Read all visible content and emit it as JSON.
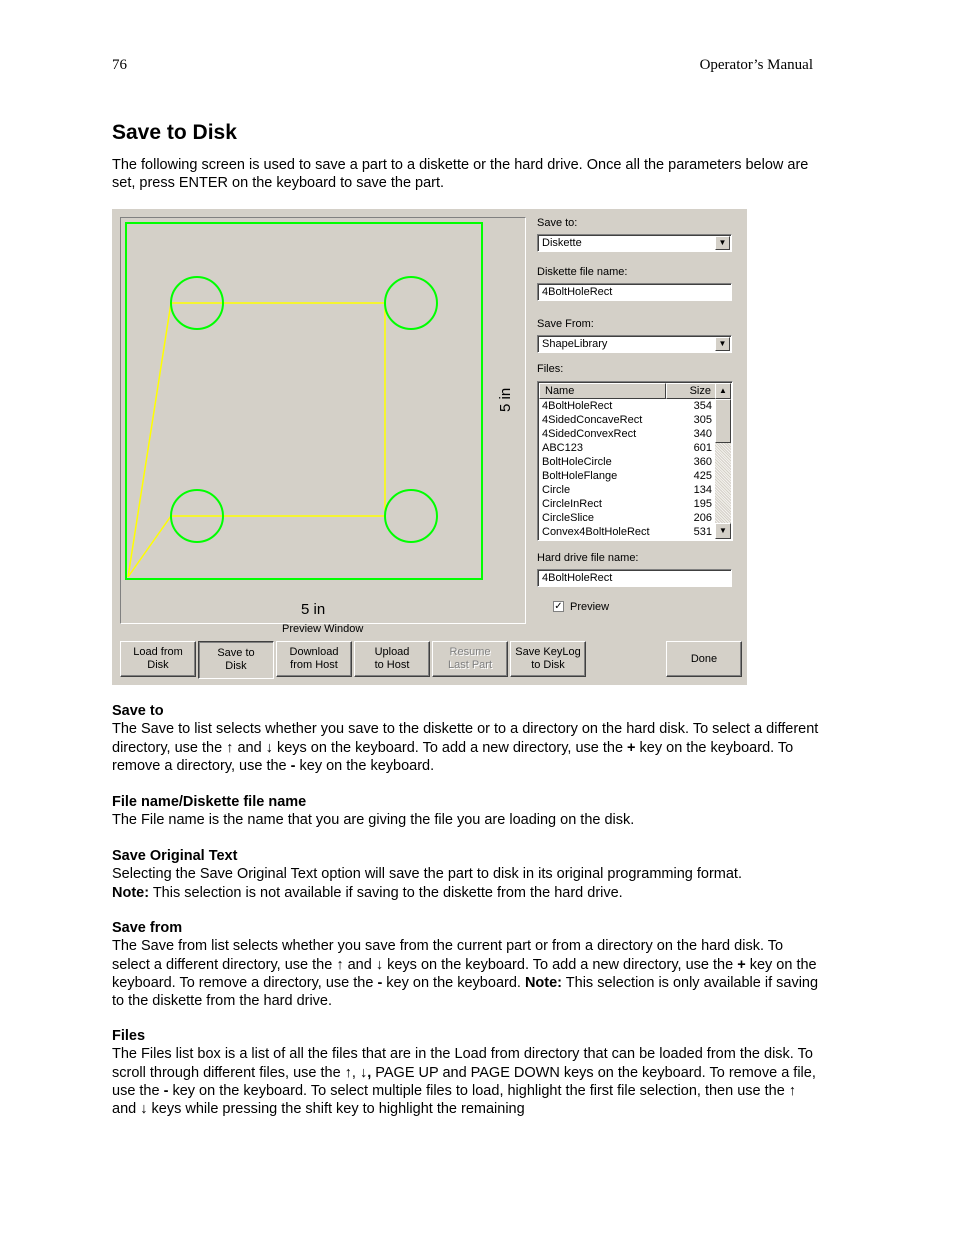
{
  "header": {
    "page_number": "76",
    "manual_title": "Operator’s Manual"
  },
  "title": "Save to Disk",
  "intro": "The following screen is used to save a part to a diskette or the hard drive.  Once all the parameters below are set, press ENTER on the keyboard to save the part.",
  "screen": {
    "preview_dim_x": "5 in",
    "preview_dim_y": "5 in",
    "preview_caption": "Preview Window",
    "save_to_label": "Save to:",
    "save_to_value": "Diskette",
    "diskette_file_label": "Diskette file name:",
    "diskette_file_value": "4BoltHoleRect",
    "save_from_label": "Save From:",
    "save_from_value": "ShapeLibrary",
    "files_label": "Files:",
    "col_name": "Name",
    "col_size": "Size",
    "files": [
      {
        "name": "4BoltHoleRect",
        "size": "354"
      },
      {
        "name": "4SidedConcaveRect",
        "size": "305"
      },
      {
        "name": "4SidedConvexRect",
        "size": "340"
      },
      {
        "name": "ABC123",
        "size": "601"
      },
      {
        "name": "BoltHoleCircle",
        "size": "360"
      },
      {
        "name": "BoltHoleFlange",
        "size": "425"
      },
      {
        "name": "Circle",
        "size": "134"
      },
      {
        "name": "CircleInRect",
        "size": "195"
      },
      {
        "name": "CircleSlice",
        "size": "206"
      },
      {
        "name": "Convex4BoltHoleRect",
        "size": "531"
      }
    ],
    "hard_drive_label": "Hard drive file name:",
    "hard_drive_value": "4BoltHoleRect",
    "preview_check_label": "Preview",
    "preview_checked": "✓",
    "buttons": {
      "load_l1": "Load from",
      "load_l2": "Disk",
      "save_l1": "Save to",
      "save_l2": "Disk",
      "download_l1": "Download",
      "download_l2": "from Host",
      "upload_l1": "Upload",
      "upload_l2": "to Host",
      "resume_l1": "Resume",
      "resume_l2": "Last Part",
      "keylog_l1": "Save KeyLog",
      "keylog_l2": "to Disk",
      "done": "Done"
    }
  },
  "sections": {
    "save_to": {
      "heading": "Save to",
      "t1": "The Save to list selects whether you save to the diskette or to a directory on the hard disk.  To select a different directory, use the ↑ and ↓ keys on the keyboard.  To add a new directory, use the ",
      "plus": "+",
      "t2": " key on the keyboard.  To remove a directory, use the ",
      "minus": "-",
      "t3": " key on the keyboard."
    },
    "file_name": {
      "heading": "File name/Diskette file name",
      "t1": "The File name is the name that you are giving the file you are loading on the disk."
    },
    "original_text": {
      "heading": "Save Original Text",
      "t1": "Selecting the Save Original Text option will save the part to disk in its original programming format.",
      "note": "Note:",
      "t2": " This selection is not available if saving to the diskette from the hard drive."
    },
    "save_from": {
      "heading": "Save from",
      "t1": "The Save from list selects whether you save from the current part or from a directory on the hard disk.  To select a different directory, use the ↑ and ↓ keys on the keyboard.  To add a new directory, use the ",
      "plus": "+",
      "t2": " key on the keyboard.  To remove a directory, use the ",
      "minus": "-",
      "t3": " key on the keyboard.  ",
      "note": "Note:",
      "t4": " This selection is only available if saving to the diskette from the hard drive."
    },
    "files": {
      "heading": "Files",
      "t1": "The Files list box is a list of all the files that are in the Load from directory that can be loaded from the disk.  To scroll through different files, use the ↑, ",
      "down": "↓,",
      "t2": " PAGE UP and PAGE DOWN keys on the keyboard.  To remove a file, use the ",
      "minus": "-",
      "t3": " key on the keyboard.  To select multiple files to load, highlight the first file selection, then use the ↑ and ↓ keys while pressing the shift key to highlight the remaining"
    }
  }
}
